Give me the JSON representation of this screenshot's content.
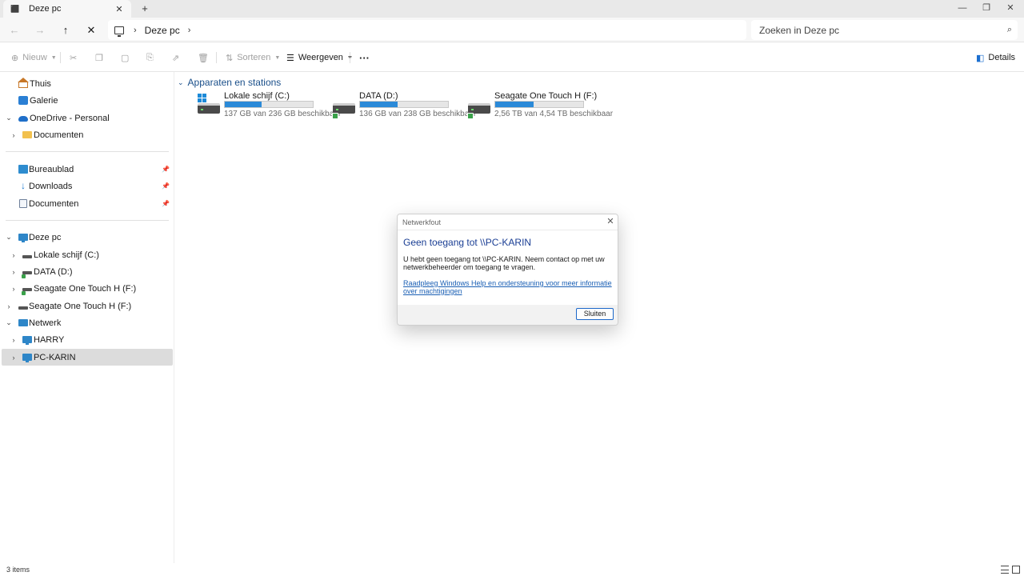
{
  "window": {
    "tab_title": "Deze pc",
    "tab_close": "✕",
    "new_tab": "+",
    "minimize": "—",
    "restore": "❐",
    "close": "✕"
  },
  "address": {
    "crumbs": [
      "Deze pc"
    ],
    "search_placeholder": "Zoeken in Deze pc"
  },
  "toolbar": {
    "new_label": "Nieuw",
    "sort_label": "Sorteren",
    "view_label": "Weergeven",
    "more_label": "···",
    "details_label": "Details"
  },
  "sidebar": {
    "items": [
      {
        "label": "Thuis",
        "icon": "home-icon"
      },
      {
        "label": "Galerie",
        "icon": "gallery-icon"
      },
      {
        "label": "OneDrive - Personal",
        "icon": "onedrive-icon"
      },
      {
        "label": "Documenten",
        "icon": "folder-icon"
      },
      {
        "label": "Bureaublad",
        "icon": "desktop-icon",
        "pinned": true
      },
      {
        "label": "Downloads",
        "icon": "download-icon",
        "pinned": true
      },
      {
        "label": "Documenten",
        "icon": "documents-icon",
        "pinned": true
      },
      {
        "label": "Deze pc",
        "icon": "this-pc-icon"
      },
      {
        "label": "Lokale schijf (C:)",
        "icon": "drive-icon"
      },
      {
        "label": "DATA (D:)",
        "icon": "network-drive-icon"
      },
      {
        "label": "Seagate One Touch H (F:)",
        "icon": "network-drive-icon"
      },
      {
        "label": "Seagate One Touch H (F:)",
        "icon": "drive-icon"
      },
      {
        "label": "Netwerk",
        "icon": "network-icon"
      },
      {
        "label": "HARRY",
        "icon": "computer-icon"
      },
      {
        "label": "PC-KARIN",
        "icon": "computer-icon",
        "selected": true
      }
    ]
  },
  "main": {
    "section_title": "Apparaten en stations",
    "drives": [
      {
        "name": "Lokale schijf (C:)",
        "free_text": "137 GB van 236 GB beschikbaar",
        "used_fraction": 0.42,
        "icon": "windows-drive-icon"
      },
      {
        "name": "DATA (D:)",
        "free_text": "136 GB van 238 GB beschikbaar",
        "used_fraction": 0.43,
        "icon": "network-drive-icon"
      },
      {
        "name": "Seagate One Touch H (F:)",
        "free_text": "2,56 TB van 4,54 TB beschikbaar",
        "used_fraction": 0.44,
        "icon": "network-drive-icon"
      }
    ]
  },
  "dialog": {
    "title": "Netwerkfout",
    "heading": "Geen toegang tot \\\\PC-KARIN",
    "message": "U hebt geen toegang tot \\\\PC-KARIN. Neem contact op met uw netwerkbeheerder om toegang te vragen.",
    "link": "Raadpleeg Windows Help en ondersteuning voor meer informatie over machtigingen",
    "ok_label": "Sluiten"
  },
  "status": {
    "item_count": "3 items"
  },
  "colors": {
    "accent": "#2b8ad8",
    "dialog_heading": "#1a3e94",
    "link": "#1a5fb4",
    "selected_bg": "#dcdcdc"
  }
}
